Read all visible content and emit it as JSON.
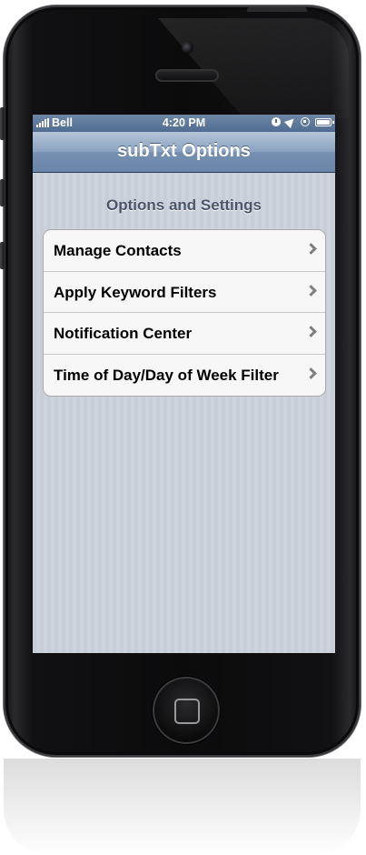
{
  "status_bar": {
    "carrier": "Bell",
    "time": "4:20 PM"
  },
  "nav_bar": {
    "title": "subTxt Options"
  },
  "section": {
    "header": "Options and Settings"
  },
  "menu": {
    "items": [
      {
        "label": "Manage Contacts",
        "icon": "chevron-right-icon"
      },
      {
        "label": "Apply Keyword Filters",
        "icon": "chevron-right-icon"
      },
      {
        "label": "Notification Center",
        "icon": "chevron-right-icon"
      },
      {
        "label": "Time of Day/Day of Week Filter",
        "icon": "chevron-right-icon"
      }
    ]
  },
  "colors": {
    "navbar": "#7690b2",
    "statusbar": "#506c92",
    "background": "#c8ced8",
    "section_header": "#4c566a"
  }
}
